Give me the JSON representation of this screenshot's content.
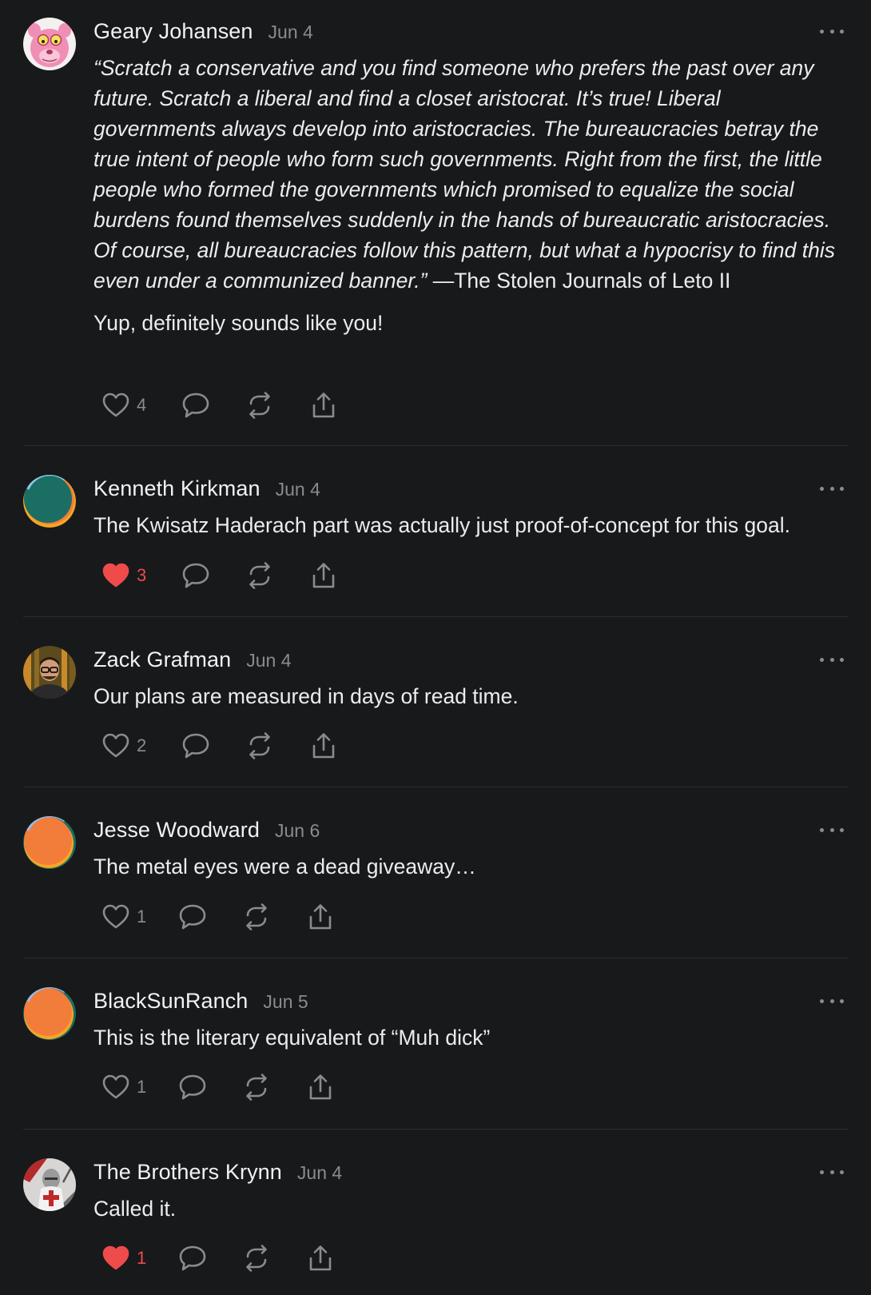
{
  "comments": [
    {
      "author": "Geary Johansen",
      "date": "Jun 4",
      "avatar": "pink-panther-avatar",
      "quote": "“Scratch a conservative and you find someone who prefers the past over any future. Scratch a liberal and find a closet aristocrat. It’s true! Liberal governments always develop into aristocracies. The bureaucracies betray the true intent of people who form such governments. Right from the first, the little people who formed the governments which promised to equalize the social burdens found themselves suddenly in the hands of bureaucratic aristocracies. Of course, all bureaucracies follow this pattern, but what a hypocrisy to find this even under a communized banner.”",
      "attribution": " —The Stolen Journals of Leto II",
      "text": "Yup, definitely sounds like you!",
      "likes": "4",
      "liked": false
    },
    {
      "author": "Kenneth Kirkman",
      "date": "Jun 4",
      "avatar": "green-default-avatar",
      "text": "The Kwisatz Haderach part was actually just proof-of-concept for this goal.",
      "likes": "3",
      "liked": true
    },
    {
      "author": "Zack Grafman",
      "date": "Jun 4",
      "avatar": "photo-avatar",
      "text": "Our plans are measured in days of read time.",
      "likes": "2",
      "liked": false
    },
    {
      "author": "Jesse Woodward",
      "date": "Jun 6",
      "avatar": "orange-default-avatar",
      "text": "The metal eyes were a dead giveaway…",
      "likes": "1",
      "liked": false
    },
    {
      "author": "BlackSunRanch",
      "date": "Jun 5",
      "avatar": "orange-default-avatar",
      "text": "This is the literary equivalent of “Muh dick”",
      "likes": "1",
      "liked": false
    },
    {
      "author": "The Brothers Krynn",
      "date": "Jun 4",
      "avatar": "knight-avatar",
      "text": "Called it.",
      "likes": "1",
      "liked": true
    }
  ],
  "icons": {
    "like": "heart-icon",
    "reply": "comment-bubble-icon",
    "restack": "restack-icon",
    "share": "share-icon",
    "more": "more-dots-icon"
  },
  "colors": {
    "background": "#18191b",
    "text": "#ececee",
    "muted": "#8a8b90",
    "liked": "#ef4b4b",
    "divider": "#2c2d31"
  }
}
